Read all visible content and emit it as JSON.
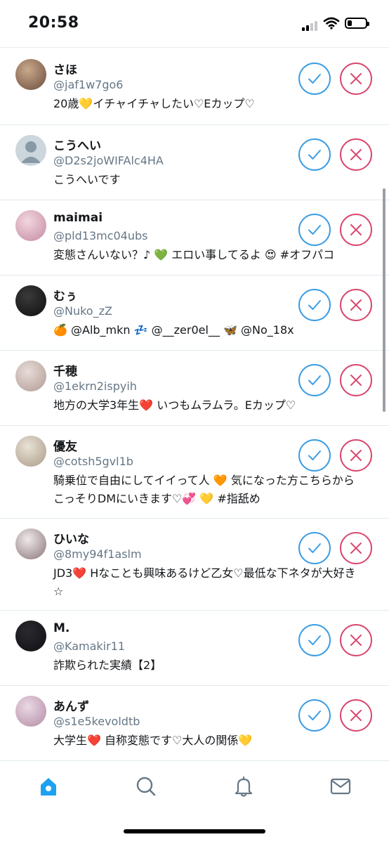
{
  "status_bar": {
    "time": "20:58",
    "battery_level": 0.25
  },
  "colors": {
    "accept": "#3b9de3",
    "decline": "#d9476d",
    "tab_active": "#1da1f2",
    "tab_inactive": "#657786"
  },
  "requests": [
    {
      "name": "さほ",
      "handle": "@jaf1w7go6",
      "bio": "20歳💛イチャイチャしたい♡Eカップ♡",
      "avatar_colors": [
        "#c9a98c",
        "#6b4c3b"
      ]
    },
    {
      "name": "こうへい",
      "handle": "@D2s2joWIFAlc4HA",
      "bio": "こうへいです",
      "avatar_colors": [
        "#ccd6dd",
        "#8899a6"
      ]
    },
    {
      "name": "maimai",
      "handle": "@pld13mc04ubs",
      "bio": "変態さんいない？♪ 💚 エロい事してるよ 😍 #オフパコ",
      "avatar_colors": [
        "#f3d6e0",
        "#c48aa0"
      ]
    },
    {
      "name": "むぅ",
      "handle": "@Nuko_zZ",
      "bio": "🍊 @Alb_mkn 💤 @__zer0el__ 🦋 @No_18x",
      "avatar_colors": [
        "#3a3a3a",
        "#0e0e0e"
      ]
    },
    {
      "name": "千穂",
      "handle": "@1ekrn2ispyih",
      "bio": "地方の大学3年生❤️ いつもムラムラ。Eカップ♡",
      "avatar_colors": [
        "#e8dcd8",
        "#b09a94"
      ]
    },
    {
      "name": "優友",
      "handle": "@cotsh5gvl1b",
      "bio": "騎乗位で自由にしてイイって人 🧡 気になった方こちらからこっそりDMにいきます♡💞 💛 #指舐め",
      "avatar_colors": [
        "#e9e2d6",
        "#a99a86"
      ]
    },
    {
      "name": "ひいな",
      "handle": "@8my94f1aslm",
      "bio": "JD3❤️ Hなことも興味あるけど乙女♡最低な下ネタが大好き☆",
      "avatar_colors": [
        "#efe9ea",
        "#8a7478"
      ]
    },
    {
      "name": "M.",
      "handle": "@Kamakir11",
      "bio": "詐欺られた実績【2】",
      "avatar_colors": [
        "#2a2a2e",
        "#101014"
      ]
    },
    {
      "name": "あんず",
      "handle": "@s1e5kevoldtb",
      "bio": "大学生❤️ 自称変態です♡大人の関係💛",
      "avatar_colors": [
        "#ead9e4",
        "#b38aa5"
      ]
    }
  ],
  "tabs": [
    {
      "icon": "home-icon",
      "active": true
    },
    {
      "icon": "search-icon",
      "active": false
    },
    {
      "icon": "bell-icon",
      "active": false
    },
    {
      "icon": "mail-icon",
      "active": false
    }
  ]
}
